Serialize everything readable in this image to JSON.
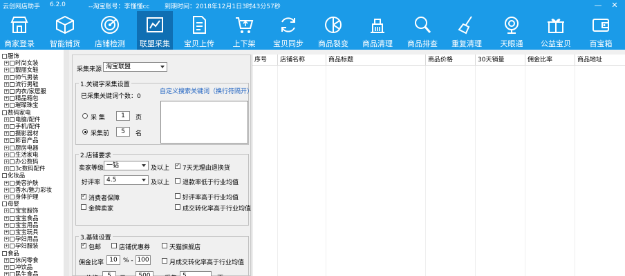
{
  "window": {
    "app_name": "云创网店助手",
    "version": "6.2.0",
    "account": "--淘宝账号：李懂懂cc",
    "expiry": "到期时间：2018年12月1日3时43分57秒",
    "min_glyph": "—",
    "close_glyph": "✕"
  },
  "toolbar": [
    {
      "label": "商家登录",
      "icon": "storefront-icon"
    },
    {
      "label": "智能铺货",
      "icon": "box-icon"
    },
    {
      "label": "店铺检测",
      "icon": "radar-icon"
    },
    {
      "label": "联盟采集",
      "icon": "collect-icon",
      "active": true
    },
    {
      "label": "宝贝上传",
      "icon": "document-upload-icon"
    },
    {
      "label": "上下架",
      "icon": "cart-icon"
    },
    {
      "label": "宝贝同步",
      "icon": "sync-icon"
    },
    {
      "label": "商品裂变",
      "icon": "split-icon"
    },
    {
      "label": "商品清理",
      "icon": "clean-icon"
    },
    {
      "label": "商品排查",
      "icon": "search-icon"
    },
    {
      "label": "重复清理",
      "icon": "broom-icon"
    },
    {
      "label": "天眼通",
      "icon": "camera-icon"
    },
    {
      "label": "公益宝贝",
      "icon": "gift-icon"
    },
    {
      "label": "百宝箱",
      "icon": "wallet-icon"
    }
  ],
  "tree": [
    {
      "label": "服饰",
      "level": 0
    },
    {
      "label": "时尚女装",
      "level": 1
    },
    {
      "label": "靓丽女鞋",
      "level": 1
    },
    {
      "label": "帅气男装",
      "level": 1
    },
    {
      "label": "流行男鞋",
      "level": 1
    },
    {
      "label": "内衣/家居服",
      "level": 1
    },
    {
      "label": "精品箱包",
      "level": 1
    },
    {
      "label": "璀璨珠宝",
      "level": 1
    },
    {
      "label": "数码家电",
      "level": 0
    },
    {
      "label": "电脑/配件",
      "level": 1
    },
    {
      "label": "手机/配件",
      "level": 1
    },
    {
      "label": "摄影器材",
      "level": 1
    },
    {
      "label": "影音产品",
      "level": 1
    },
    {
      "label": "厨房电器",
      "level": 1
    },
    {
      "label": "生活家电",
      "level": 1
    },
    {
      "label": "办公数码",
      "level": 1
    },
    {
      "label": "3c数码配件",
      "level": 1
    },
    {
      "label": "化妆品",
      "level": 0
    },
    {
      "label": "美容护肤",
      "level": 1
    },
    {
      "label": "香水/魅力彩妆",
      "level": 1
    },
    {
      "label": "身体护理",
      "level": 1
    },
    {
      "label": "母婴",
      "level": 0
    },
    {
      "label": "宝宝服饰",
      "level": 1
    },
    {
      "label": "宝宝食品",
      "level": 1
    },
    {
      "label": "宝宝用品",
      "level": 1
    },
    {
      "label": "宝宝玩具",
      "level": 1
    },
    {
      "label": "孕妇用品",
      "level": 1
    },
    {
      "label": "孕妇服装",
      "level": 1
    },
    {
      "label": "食品",
      "level": 0
    },
    {
      "label": "休闲零食",
      "level": 1
    },
    {
      "label": "冲饮品",
      "level": 1
    },
    {
      "label": "民生食品",
      "level": 1
    }
  ],
  "source": {
    "label": "采集来源",
    "value": "淘宝联盟"
  },
  "keywords": {
    "group_title": "1.关键字采集设置",
    "count_label": "已采集关键词个数：0",
    "custom_link": "自定义搜索关键词（换行符隔开）",
    "opt1_label": "采 集",
    "opt1_value": "1",
    "opt1_unit": "页",
    "opt2_label": "采集前",
    "opt2_value": "5",
    "opt2_unit": "名"
  },
  "shop": {
    "group_title": "2.店铺要求",
    "level_label": "卖家等级",
    "level_value": "一钻",
    "level_suffix": "及以上",
    "rating_label": "好评率",
    "rating_value": "4.5",
    "rating_suffix": "及以上",
    "checks": [
      {
        "label": "7天无理由退换货",
        "checked": true
      },
      {
        "label": "退款率低于行业均值",
        "checked": false
      },
      {
        "label": "好评率高于行业均值",
        "checked": false
      },
      {
        "label": "成交转化率高于行业均值",
        "checked": false
      },
      {
        "label": "消费者保障",
        "checked": true
      },
      {
        "label": "金牌卖家",
        "checked": false
      }
    ]
  },
  "basic": {
    "group_title": "3.基础设置",
    "check_baoyou": "包邮",
    "check_coupon": "店铺优惠券",
    "check_tmall": "天猫旗舰店",
    "commission_label": "佣金比率",
    "commission_min": "10",
    "commission_sep": "% -",
    "commission_max": "100",
    "check_monthly": "月成交转化率高于行业均值",
    "price_label": "价格",
    "price_min": "5",
    "price_sep": "元 -",
    "price_max": "500",
    "collect_label": "采集",
    "collect_value": "5",
    "collect_unit": "页"
  },
  "table": {
    "columns": [
      "序号",
      "店铺名称",
      "商品标题",
      "商品价格",
      "30天销量",
      "佣金比率",
      "商品地址"
    ]
  }
}
